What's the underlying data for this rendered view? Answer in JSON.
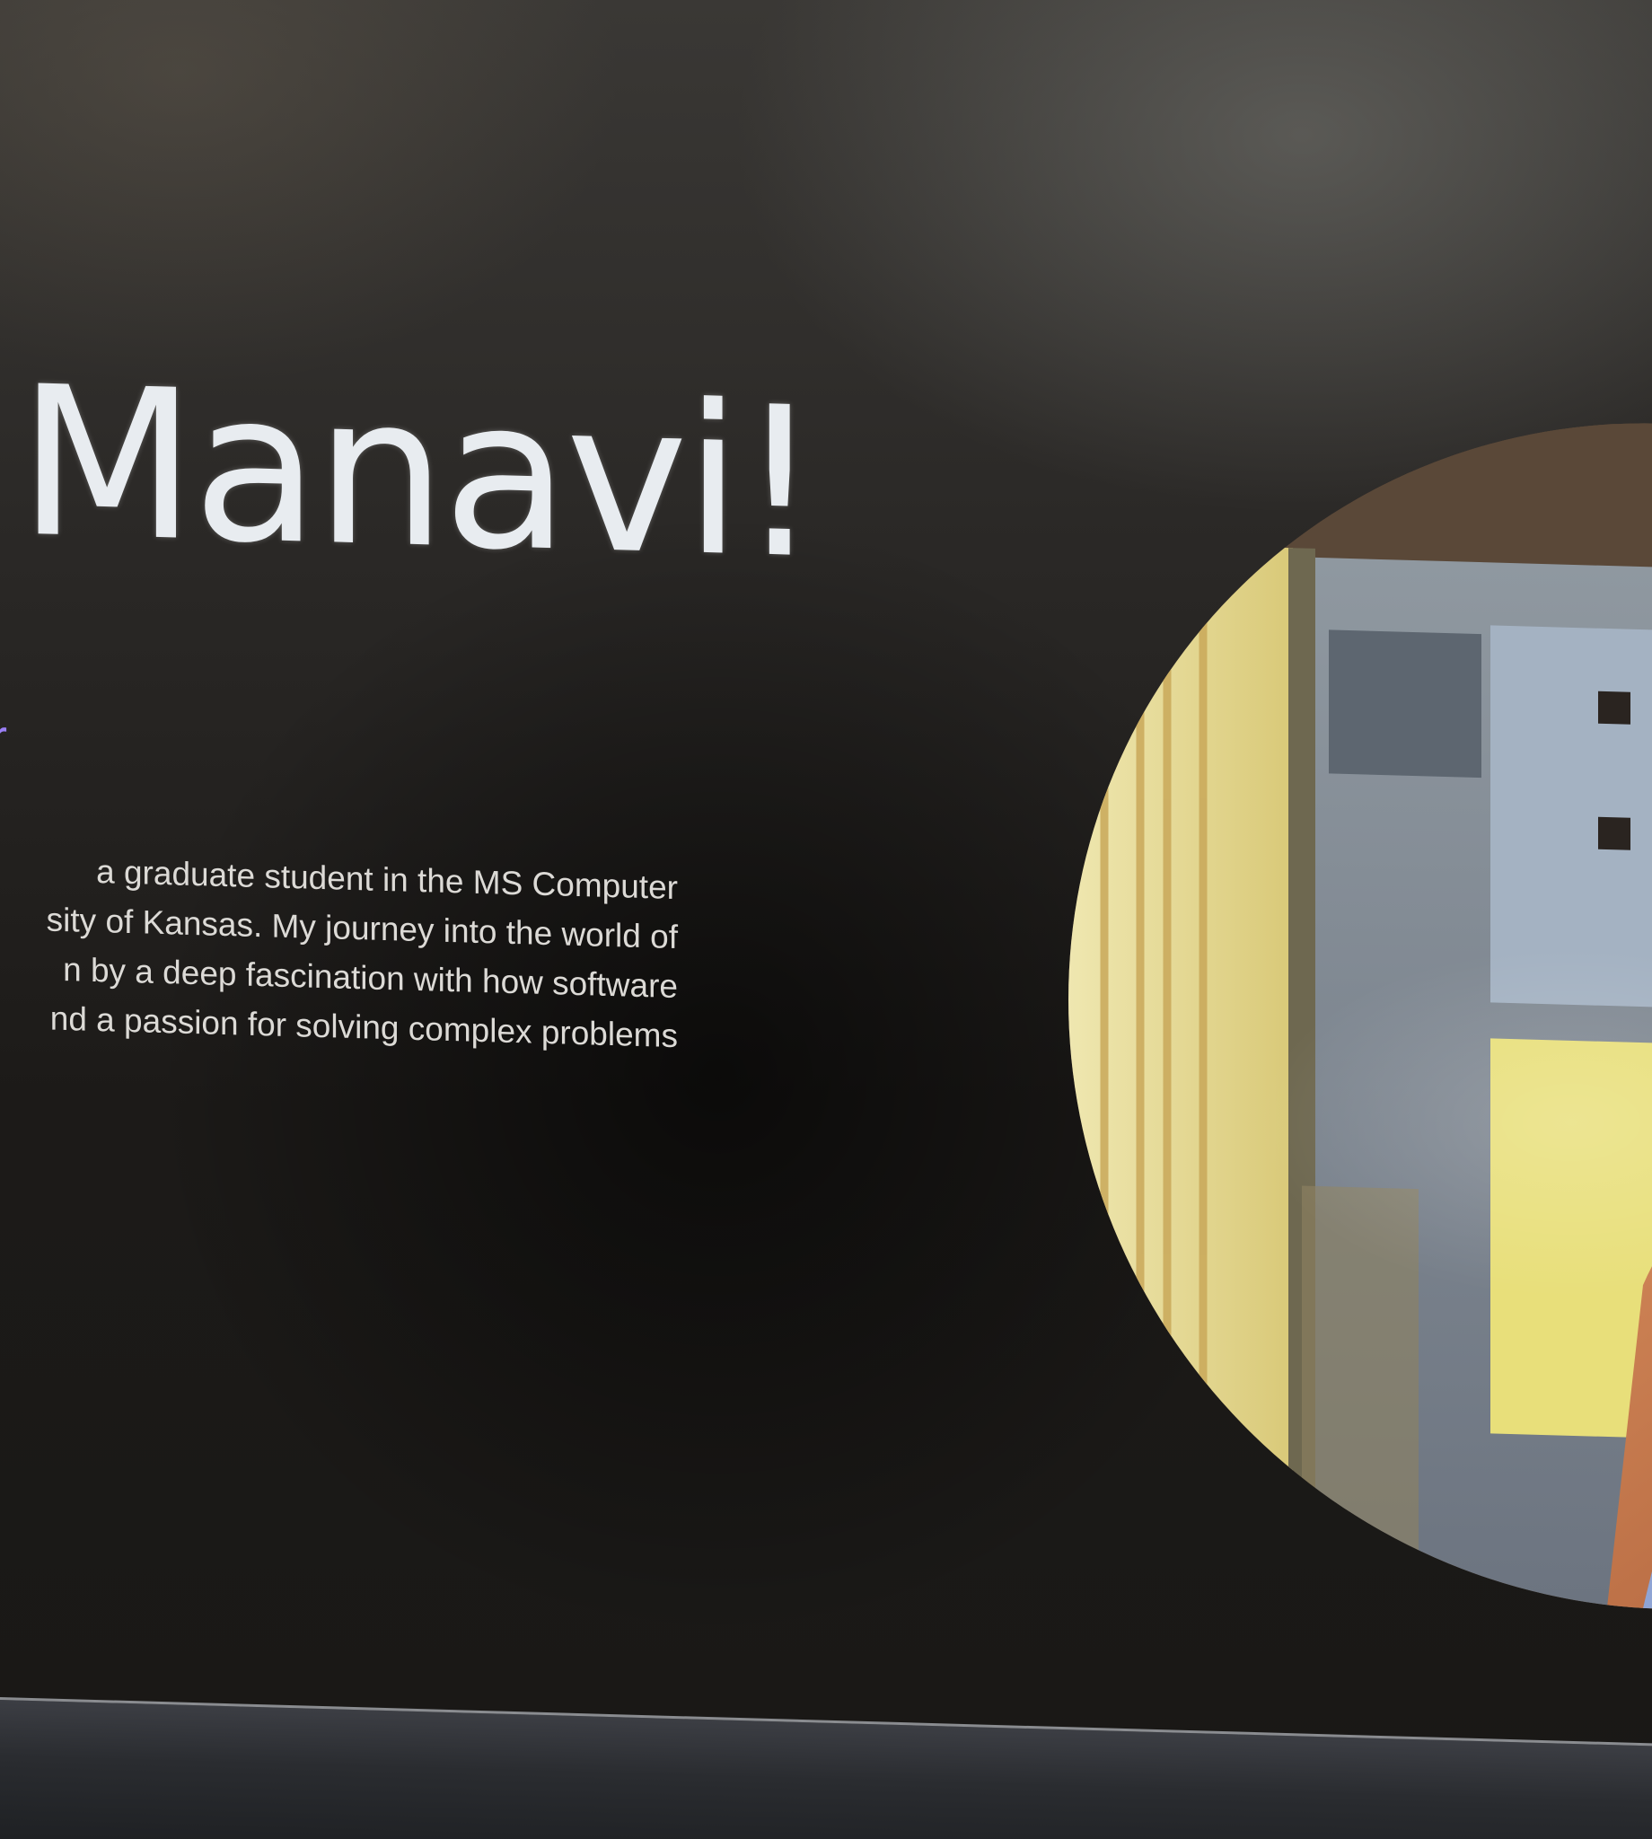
{
  "hero": {
    "greeting": "Manavi!",
    "role_fragment": "r",
    "bio_lines": [
      "a graduate student in the MS Computer",
      "sity of Kansas. My journey into the world of",
      "n by a deep fascination with how software",
      "nd a passion for solving complex problems"
    ]
  },
  "colors": {
    "background": "#141210",
    "heading": "#e8ecf0",
    "accent": "#9a7ff5",
    "body_text": "#dcdad6"
  }
}
